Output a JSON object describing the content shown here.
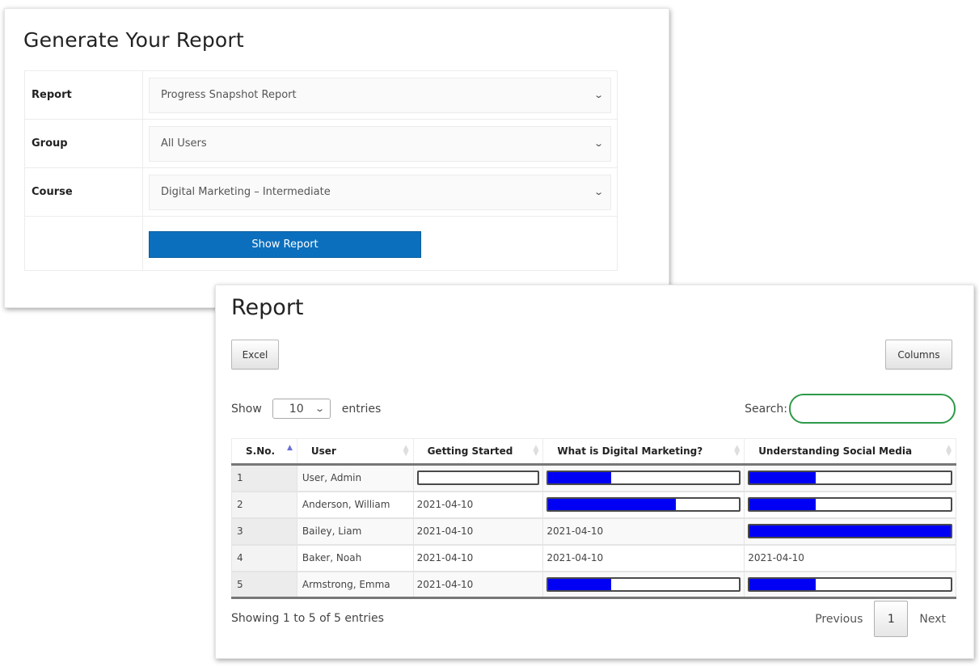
{
  "generate": {
    "title": "Generate Your Report",
    "fields": [
      {
        "label": "Report",
        "value": "Progress Snapshot Report"
      },
      {
        "label": "Group",
        "value": "All Users"
      },
      {
        "label": "Course",
        "value": "Digital Marketing – Intermediate"
      }
    ],
    "show_button": "Show Report"
  },
  "report": {
    "title": "Report",
    "excel_button": "Excel",
    "columns_button": "Columns",
    "length": {
      "prefix": "Show",
      "value": "10",
      "suffix": "entries"
    },
    "search": {
      "label": "Search:",
      "value": ""
    },
    "columns": [
      "S.No.",
      "User",
      "Getting Started",
      "What is Digital Marketing?",
      "Understanding Social Media"
    ],
    "sort": {
      "column": "S.No.",
      "direction": "ascending"
    },
    "rows": [
      {
        "sno": "1",
        "user": "User, Admin",
        "cells": [
          {
            "type": "progress",
            "percent": 0
          },
          {
            "type": "progress",
            "percent": 33
          },
          {
            "type": "progress",
            "percent": 33
          }
        ]
      },
      {
        "sno": "2",
        "user": "Anderson, William",
        "cells": [
          {
            "type": "date",
            "value": "2021-04-10"
          },
          {
            "type": "progress",
            "percent": 67
          },
          {
            "type": "progress",
            "percent": 33
          }
        ]
      },
      {
        "sno": "3",
        "user": "Bailey, Liam",
        "cells": [
          {
            "type": "date",
            "value": "2021-04-10"
          },
          {
            "type": "date",
            "value": "2021-04-10"
          },
          {
            "type": "progress",
            "percent": 100
          }
        ]
      },
      {
        "sno": "4",
        "user": "Baker, Noah",
        "cells": [
          {
            "type": "date",
            "value": "2021-04-10"
          },
          {
            "type": "date",
            "value": "2021-04-10"
          },
          {
            "type": "date",
            "value": "2021-04-10"
          }
        ]
      },
      {
        "sno": "5",
        "user": "Armstrong, Emma",
        "cells": [
          {
            "type": "date",
            "value": "2021-04-10"
          },
          {
            "type": "progress",
            "percent": 33
          },
          {
            "type": "progress",
            "percent": 33
          }
        ]
      }
    ],
    "info": "Showing 1 to 5 of 5 entries",
    "pagination": {
      "previous": "Previous",
      "current": "1",
      "next": "Next"
    },
    "progress_color": "#0000f5"
  },
  "colors": {
    "primary_button": "#0b6fbd",
    "search_border": "#2e9a4a",
    "sort_active": "#6a6fd6"
  }
}
